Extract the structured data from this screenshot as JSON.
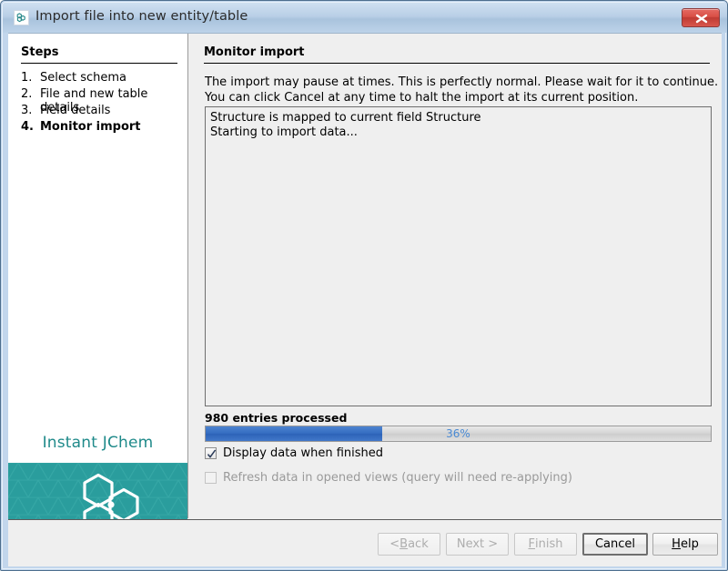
{
  "window": {
    "title": "Import file into new entity/table",
    "app_icon": "molecule-icon",
    "close_label": "×",
    "title_bar_color": "#b4cbe3",
    "border_color": "#4e6f8e"
  },
  "sidebar": {
    "heading": "Steps",
    "steps": [
      {
        "number": "1.",
        "label": "Select schema",
        "current": false
      },
      {
        "number": "2.",
        "label": "File and new table details",
        "current": false
      },
      {
        "number": "3.",
        "label": "Field details",
        "current": false
      },
      {
        "number": "4.",
        "label": "Monitor import",
        "current": true
      }
    ],
    "brand": {
      "name": "Instant JChem",
      "name_color": "#1f8a8a",
      "panel_color": "#2a9d9d",
      "logo_icon": "hexagon-molecule-icon"
    }
  },
  "main": {
    "heading": "Monitor import",
    "intro_line_1": "The import may pause at times. This is perfectly normal. Please wait for it to continue.",
    "intro_line_2": "You can click Cancel at any time to halt the import at its current position.",
    "log": [
      "Structure is mapped to current field Structure",
      "Starting to import data..."
    ],
    "progress": {
      "status_text": "980 entries processed",
      "percent_label": "36%",
      "percent_value": 35,
      "fill_color": "#336bc0",
      "text_color": "#4a8ad4"
    },
    "options": [
      {
        "id": "display-data-when-finished",
        "label": "Display data when finished",
        "checked": true,
        "enabled": true
      },
      {
        "id": "refresh-data-in-opened-views",
        "label": "Refresh data in opened views (query will need re-applying)",
        "checked": false,
        "enabled": false
      }
    ]
  },
  "buttons": {
    "back": {
      "prefix": "< ",
      "mnemonic": "B",
      "suffix": "ack",
      "enabled": false,
      "default": false
    },
    "next": {
      "prefix": "",
      "mnemonic": "N",
      "suffix": "ext >",
      "enabled": false,
      "default": false
    },
    "finish": {
      "prefix": "",
      "mnemonic": "F",
      "suffix": "inish",
      "enabled": false,
      "default": false
    },
    "cancel": {
      "prefix": "",
      "mnemonic": "",
      "suffix": "Cancel",
      "enabled": true,
      "default": true
    },
    "help": {
      "prefix": "",
      "mnemonic": "H",
      "suffix": "elp",
      "enabled": true,
      "default": false
    }
  }
}
